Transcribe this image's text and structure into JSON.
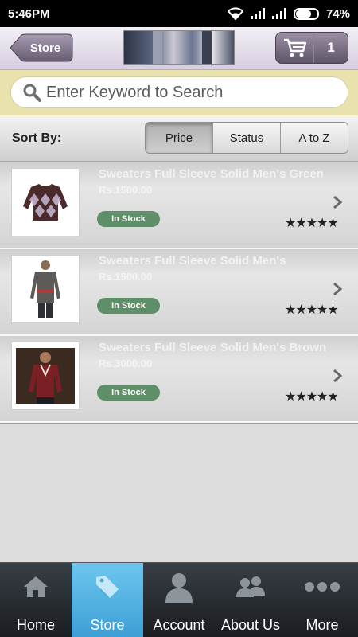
{
  "status_bar": {
    "time": "5:46PM",
    "battery": "74%",
    "battery_level": 0.74
  },
  "header": {
    "back_label": "Store",
    "cart_count": "1"
  },
  "search": {
    "placeholder": "Enter Keyword to Search"
  },
  "sort": {
    "label": "Sort By:",
    "options": [
      "Price",
      "Status",
      "A to Z"
    ],
    "selected": "Price"
  },
  "products": [
    {
      "title": "Sweaters Full Sleeve Solid Men's Green",
      "price": "Rs.1500.00",
      "stock": "In Stock",
      "stars": "★★★★★"
    },
    {
      "title": "Sweaters Full Sleeve Solid Men's",
      "price": "Rs.1500.00",
      "stock": "In Stock",
      "stars": "★★★★★"
    },
    {
      "title": "Sweaters Full Sleeve Solid Men's Brown",
      "price": "Rs.3000.00",
      "stock": "In Stock",
      "stars": "★★★★★"
    }
  ],
  "tabs": [
    {
      "label": "Home",
      "icon": "home-icon"
    },
    {
      "label": "Store",
      "icon": "price-tag-icon",
      "active": true
    },
    {
      "label": "Account",
      "icon": "person-icon"
    },
    {
      "label": "About Us",
      "icon": "people-icon"
    },
    {
      "label": "More",
      "icon": "more-dots-icon"
    }
  ],
  "colors": {
    "header_bg": "#dcd3e4",
    "search_band": "#e9e2ad",
    "in_stock_badge": "#5f8f68",
    "active_tab": "#4aaee0",
    "tabbar_bg": "#23272c"
  }
}
